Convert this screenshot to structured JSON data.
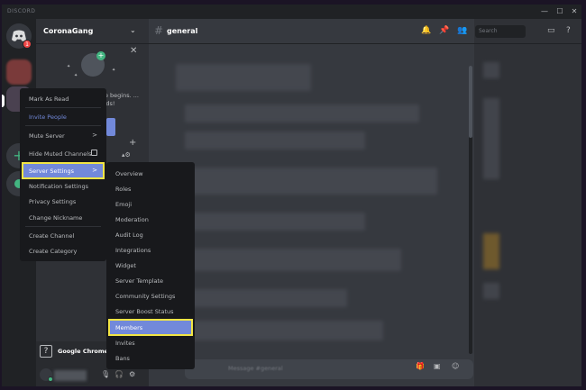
{
  "app": {
    "title": "DISCORD"
  },
  "window_controls": {
    "minimize": "—",
    "maximize": "☐",
    "close": "✕"
  },
  "servers": {
    "home_badge": "1"
  },
  "server": {
    "name": "CoronaGang",
    "chevron": "⌄"
  },
  "welcome": {
    "close": "✕",
    "text": "An adventure begins. ... friends!"
  },
  "channel": {
    "hash": "#",
    "name": "general"
  },
  "search": {
    "placeholder": "Search"
  },
  "context_menu": {
    "items": [
      {
        "label": "Mark As Read"
      },
      {
        "label": "Invite People"
      },
      {
        "label": "Mute Server",
        "chevron": ">"
      },
      {
        "label": "Hide Muted Channels"
      },
      {
        "label": "Server Settings",
        "chevron": ">"
      },
      {
        "label": "Notification Settings"
      },
      {
        "label": "Privacy Settings"
      },
      {
        "label": "Change Nickname"
      },
      {
        "label": "Create Channel"
      },
      {
        "label": "Create Category"
      }
    ]
  },
  "submenu": {
    "items": [
      "Overview",
      "Roles",
      "Emoji",
      "Moderation",
      "Audit Log",
      "Integrations",
      "Widget",
      "Server Template",
      "Community Settings",
      "Server Boost Status",
      "Members",
      "Invites",
      "Bans"
    ]
  },
  "voice": {
    "icon": "?",
    "app": "Google Chrome"
  },
  "chat": {
    "placeholder": "Message #general"
  },
  "colors": {
    "accent": "#7289da",
    "highlight": "#f2e544",
    "online": "#43b581",
    "badge": "#f04747"
  }
}
